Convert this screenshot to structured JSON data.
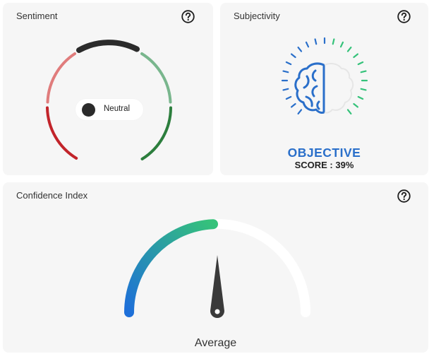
{
  "sentiment": {
    "title": "Sentiment",
    "label": "Neutral",
    "colors": {
      "negative_strong": "#c2242a",
      "negative_light": "#e07c7c",
      "neutral": "#2b2b2b",
      "positive_light": "#79b68d",
      "positive_strong": "#2c7e3d"
    }
  },
  "subjectivity": {
    "title": "Subjectivity",
    "label": "OBJECTIVE",
    "score_text": "SCORE : 39%",
    "score": 39,
    "icon": "brain-icon",
    "colors": {
      "objective": "#2a6fca",
      "subjective": "#35c27a"
    }
  },
  "confidence": {
    "title": "Confidence Index",
    "label": "Average",
    "colors": {
      "gradient_start": "#1e6fd9",
      "gradient_end": "#35c27a",
      "track": "#ffffff",
      "needle": "#3a3a3a"
    }
  },
  "help_icon": "question-circle-icon"
}
